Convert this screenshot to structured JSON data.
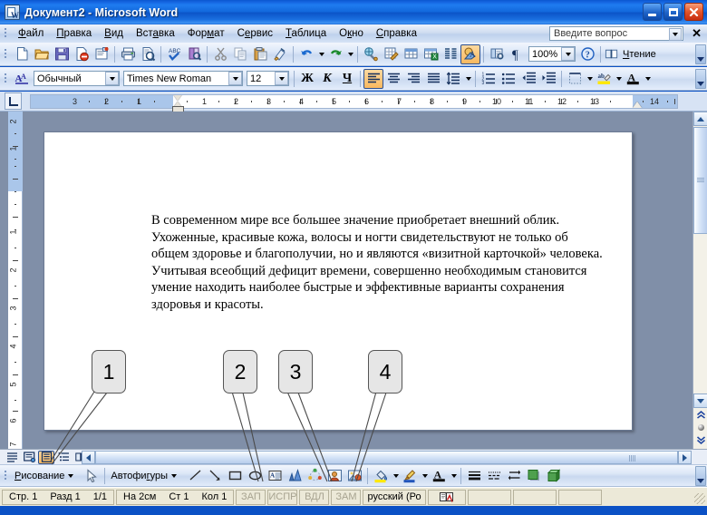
{
  "window": {
    "title": "Документ2 - Microsoft Word",
    "app_icon": "word-document-icon",
    "minimize": "–",
    "maximize": "□",
    "close": "✕"
  },
  "menu": {
    "items": [
      {
        "label": "Файл",
        "name": "menu-file"
      },
      {
        "label": "Правка",
        "name": "menu-edit"
      },
      {
        "label": "Вид",
        "name": "menu-view"
      },
      {
        "label": "Вставка",
        "name": "menu-insert"
      },
      {
        "label": "Формат",
        "name": "menu-format"
      },
      {
        "label": "Сервис",
        "name": "menu-tools"
      },
      {
        "label": "Таблица",
        "name": "menu-table"
      },
      {
        "label": "Окно",
        "name": "menu-window"
      },
      {
        "label": "Справка",
        "name": "menu-help"
      }
    ],
    "ask_placeholder": "Введите вопрос",
    "close_label": "✕"
  },
  "standard_toolbar": {
    "buttons": [
      {
        "name": "new-document-icon",
        "glyph": "new"
      },
      {
        "name": "open-folder-icon",
        "glyph": "open"
      },
      {
        "name": "save-icon",
        "glyph": "save"
      },
      {
        "name": "permission-icon",
        "glyph": "permission"
      },
      {
        "name": "email-icon",
        "glyph": "email"
      },
      {
        "name": "print-icon",
        "glyph": "print"
      },
      {
        "name": "print-preview-icon",
        "glyph": "preview"
      },
      {
        "name": "spellcheck-icon",
        "glyph": "spell"
      },
      {
        "name": "research-icon",
        "glyph": "research"
      },
      {
        "name": "cut-icon",
        "glyph": "cut"
      },
      {
        "name": "copy-icon",
        "glyph": "copy"
      },
      {
        "name": "paste-icon",
        "glyph": "paste"
      },
      {
        "name": "format-painter-icon",
        "glyph": "painter"
      },
      {
        "name": "undo-icon",
        "glyph": "undo"
      },
      {
        "name": "redo-icon",
        "glyph": "redo"
      },
      {
        "name": "insert-hyperlink-icon",
        "glyph": "hyperlink"
      },
      {
        "name": "tables-and-borders-icon",
        "glyph": "tables-borders"
      },
      {
        "name": "insert-table-icon",
        "glyph": "table"
      },
      {
        "name": "insert-excel-sheet-icon",
        "glyph": "excel"
      },
      {
        "name": "columns-icon",
        "glyph": "columns"
      },
      {
        "name": "drawing-toggle-icon",
        "glyph": "drawing"
      },
      {
        "name": "document-map-icon",
        "glyph": "docmap"
      },
      {
        "name": "show-formatting-icon",
        "glyph": "pilcrow"
      }
    ],
    "zoom_value": "100%",
    "help_icon": "help-icon",
    "reading_label": "Чтение",
    "reading_icon": "reading-book-icon",
    "overflow": "toolbar-options"
  },
  "formatting_toolbar": {
    "styles_icon": "styles-and-formatting-icon",
    "style_value": "Обычный",
    "font_value": "Times New Roman",
    "size_value": "12",
    "bold_label": "Ж",
    "italic_label": "К",
    "underline_label": "Ч",
    "buttons": [
      {
        "name": "align-left-icon",
        "glyph": "align-left",
        "active": true
      },
      {
        "name": "align-center-icon",
        "glyph": "align-center",
        "active": false
      },
      {
        "name": "align-right-icon",
        "glyph": "align-right",
        "active": false
      },
      {
        "name": "align-justify-icon",
        "glyph": "align-justify",
        "active": false
      },
      {
        "name": "line-spacing-icon",
        "glyph": "line-spacing",
        "active": false
      },
      {
        "name": "numbered-list-icon",
        "glyph": "num-list",
        "active": false
      },
      {
        "name": "bulleted-list-icon",
        "glyph": "bullet-list",
        "active": false
      },
      {
        "name": "decrease-indent-icon",
        "glyph": "dec-indent",
        "active": false
      },
      {
        "name": "increase-indent-icon",
        "glyph": "inc-indent",
        "active": false
      },
      {
        "name": "outside-border-icon",
        "glyph": "border",
        "active": false
      },
      {
        "name": "highlight-color-icon",
        "glyph": "highlight",
        "active": false
      },
      {
        "name": "font-color-icon",
        "glyph": "font-color",
        "active": false
      }
    ]
  },
  "ruler": {
    "tab_selector_icon": "left-tab-stop-icon",
    "horizontal_ticks": [
      "3",
      "2",
      "1",
      "1",
      "2",
      "3",
      "4",
      "5",
      "6",
      "7",
      "8",
      "9",
      "10",
      "11",
      "12",
      "13",
      "14"
    ],
    "vertical_ticks": [
      "2",
      "1",
      "1",
      "2",
      "3",
      "4",
      "5",
      "6",
      "7"
    ],
    "first_line_indent_icon": "first-line-indent-marker",
    "hanging_indent_icon": "hanging-indent-marker",
    "left-indent-icon": "left-indent-marker",
    "right_indent_icon": "right-indent-marker"
  },
  "document": {
    "paragraph": "В современном мире все большее значение приобретает внешний облик. Ухоженные, красивые кожа, волосы и ногти свидетельствуют не только об общем здоровье и благополучии, но и являются «визитной карточкой» человека. Учитывая всеобщий дефицит времени, совершенно необходимым становится умение находить наиболее быстрые и эффективные варианты сохранения здоровья и красоты."
  },
  "view_buttons": [
    {
      "name": "normal-view-button",
      "glyph": "normal",
      "active": false
    },
    {
      "name": "web-layout-view-button",
      "glyph": "web",
      "active": false
    },
    {
      "name": "print-layout-view-button",
      "glyph": "print-layout",
      "active": true
    },
    {
      "name": "outline-view-button",
      "glyph": "outline",
      "active": false
    },
    {
      "name": "reading-layout-view-button",
      "glyph": "reading",
      "active": false
    }
  ],
  "drawing_toolbar": {
    "menu_label": "Рисование",
    "select_icon": "select-objects-arrow-icon",
    "autoshapes_label": "Автофигуры",
    "buttons": [
      {
        "name": "line-icon",
        "glyph": "line"
      },
      {
        "name": "arrow-icon",
        "glyph": "arrow"
      },
      {
        "name": "rectangle-icon",
        "glyph": "rectangle"
      },
      {
        "name": "oval-icon",
        "glyph": "oval"
      },
      {
        "name": "text-box-icon",
        "glyph": "textbox"
      },
      {
        "name": "wordart-icon",
        "glyph": "wordart"
      },
      {
        "name": "diagram-icon",
        "glyph": "diagram"
      },
      {
        "name": "clip-art-icon",
        "glyph": "clipart"
      },
      {
        "name": "insert-picture-icon",
        "glyph": "picture"
      },
      {
        "name": "fill-color-icon",
        "glyph": "fill"
      },
      {
        "name": "line-color-icon",
        "glyph": "line-color"
      },
      {
        "name": "font-color-icon",
        "glyph": "font-color"
      },
      {
        "name": "line-style-icon",
        "glyph": "line-style"
      },
      {
        "name": "dash-style-icon",
        "glyph": "dash-style"
      },
      {
        "name": "arrow-style-icon",
        "glyph": "arrow-style"
      },
      {
        "name": "shadow-style-icon",
        "glyph": "shadow"
      },
      {
        "name": "3d-style-icon",
        "glyph": "3d"
      }
    ],
    "overflow": "toolbar-options"
  },
  "status_bar": {
    "page_label": "Стр. 1",
    "section_label": "Разд 1",
    "pages_label": "1/1",
    "at_label": "На 2см",
    "line_label": "Ст 1",
    "column_label": "Кол 1",
    "flags": [
      "ЗАП",
      "ИСПР",
      "ВДЛ",
      "ЗАМ"
    ],
    "language": "русский (Ро",
    "spell_icon": "spelling-status-icon"
  },
  "callouts": [
    {
      "label": "1",
      "name": "callout-1"
    },
    {
      "label": "2",
      "name": "callout-2"
    },
    {
      "label": "3",
      "name": "callout-3"
    },
    {
      "label": "4",
      "name": "callout-4"
    }
  ],
  "colors": {
    "title_blue": "#0b57d0",
    "toolbar_blue": "#dde8f8",
    "status_beige": "#ece9d8",
    "workspace_gray": "#808fa8",
    "accent_orange": "#f8b85f"
  }
}
